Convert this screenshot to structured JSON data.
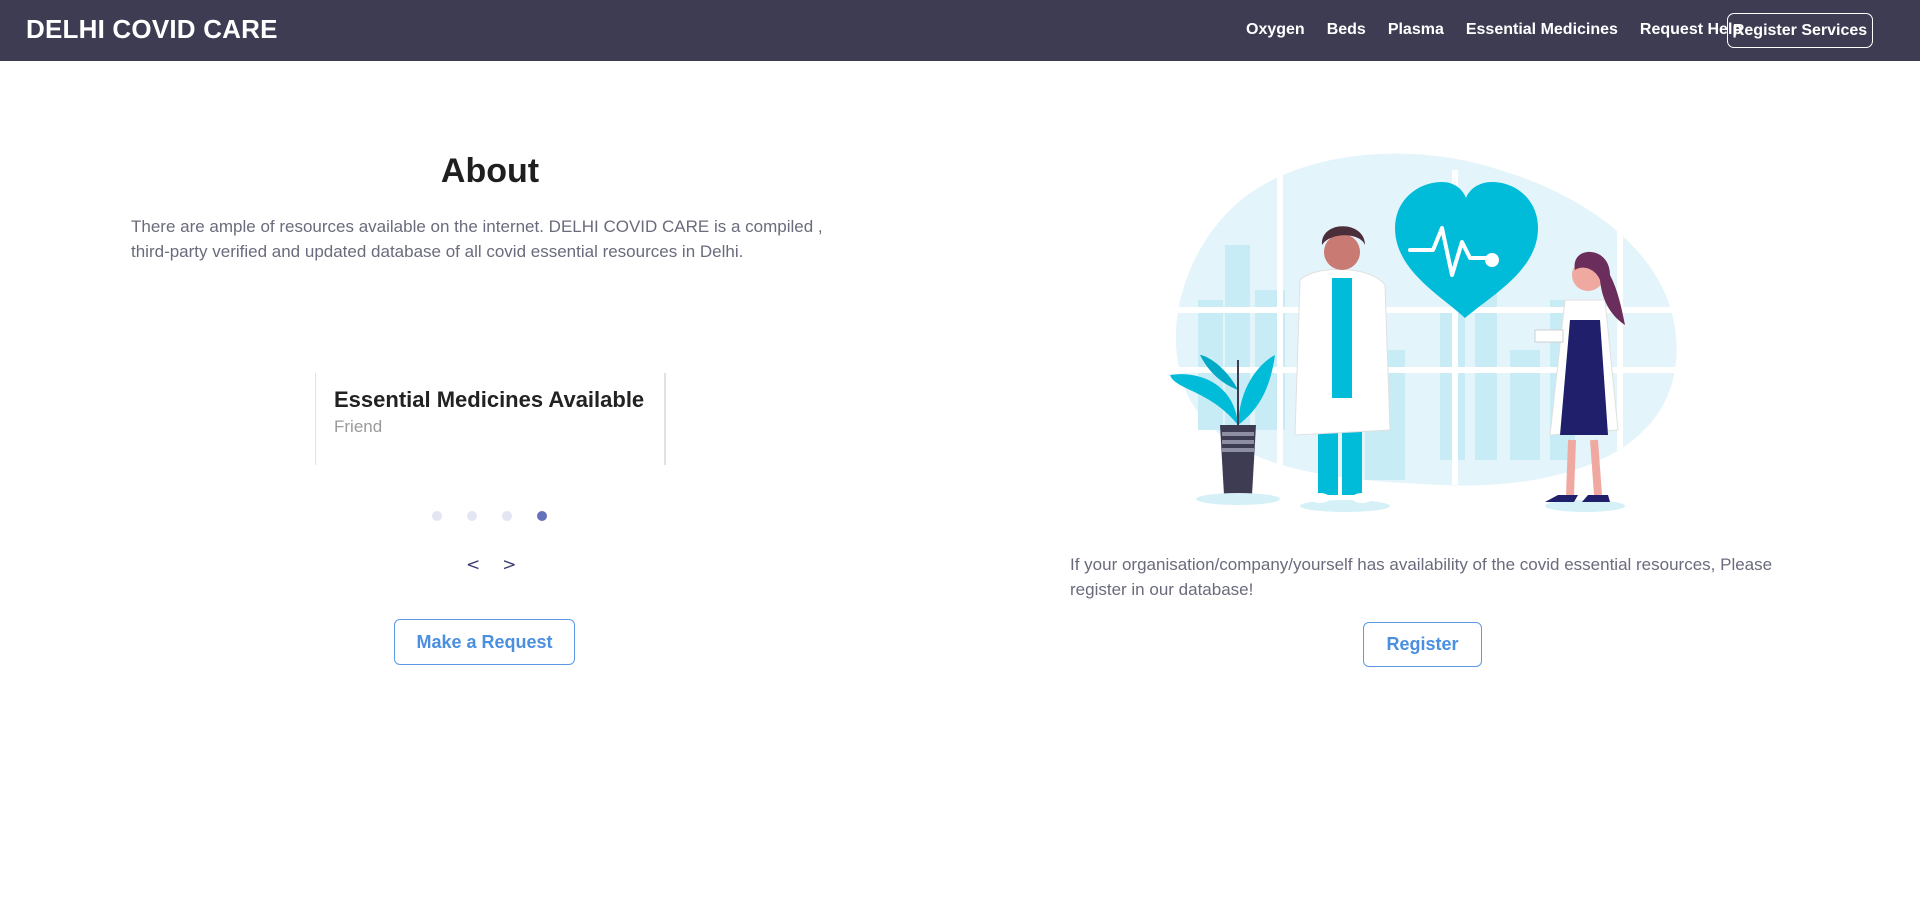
{
  "navbar": {
    "brand": "DELHI COVID CARE",
    "links": [
      "Oxygen",
      "Beds",
      "Plasma",
      "Essential Medicines",
      "Request Help"
    ],
    "register_services": "Register Services"
  },
  "about": {
    "title": "About",
    "text": "There are ample of resources available on the internet. DELHI COVID CARE is a compiled , third-party verified and updated database of all covid essential resources in Delhi."
  },
  "carousel": {
    "card_title": "Essential Medicines Available",
    "card_subtitle": "Friend",
    "dot_count": 4,
    "active_dot": 4,
    "prev": "<",
    "next": ">"
  },
  "make_request_label": "Make a Request",
  "register_section": {
    "text": "If your organisation/company/yourself has availability of the covid essential resources, Please register in our database!",
    "button": "Register"
  },
  "colors": {
    "navbar": "#3d3c53",
    "accent_blue": "#4a8fe0",
    "illustration_cyan": "#00bcd9",
    "active_dot": "#6570bd"
  }
}
